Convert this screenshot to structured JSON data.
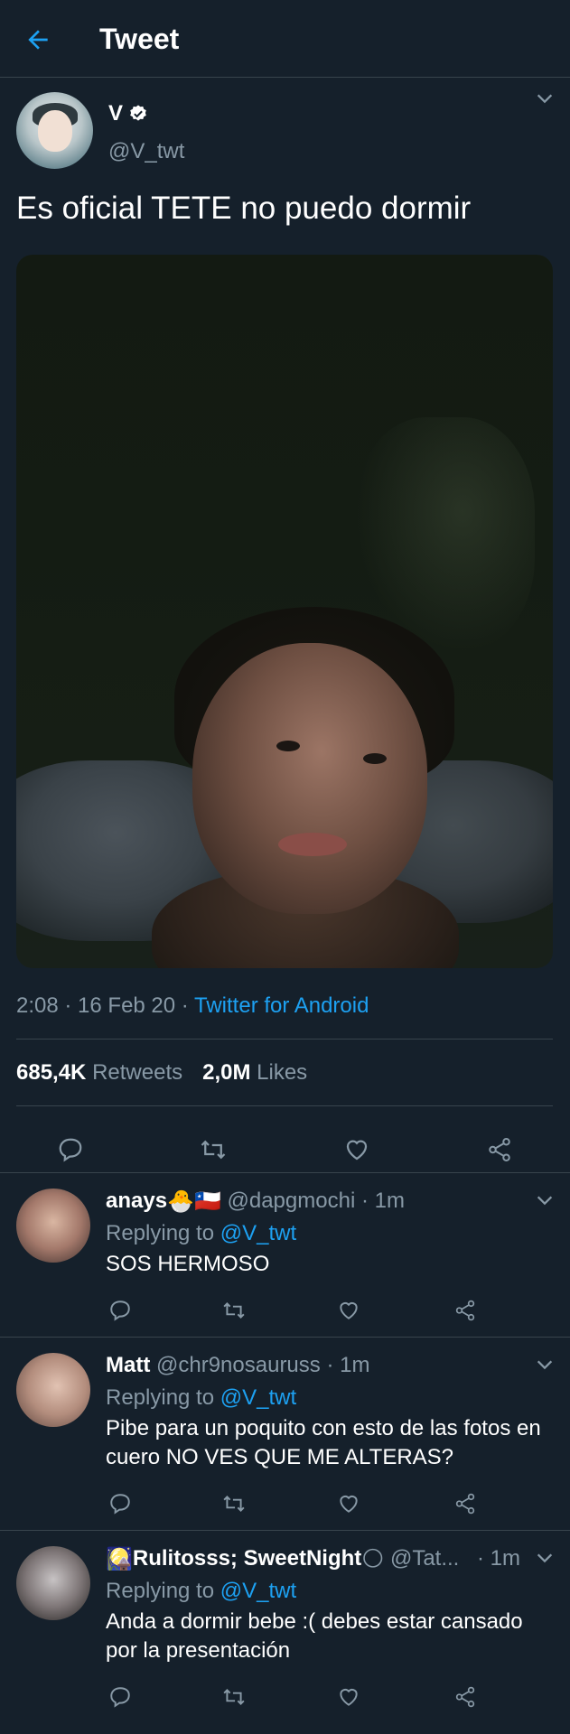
{
  "header": {
    "title": "Tweet"
  },
  "main_tweet": {
    "name": "V",
    "handle": "@V_twt",
    "text": "Es oficial TETE no puedo dormir",
    "time": "2:08 · 16 Feb 20 · ",
    "client": "Twitter for Android",
    "retweets_count": "685,4K",
    "retweets_label": "Retweets",
    "likes_count": "2,0M",
    "likes_label": "Likes"
  },
  "replies": [
    {
      "name": "anays",
      "emojis": "🐣🇨🇱",
      "handle": "@dapgmochi",
      "time": "· 1m",
      "replying_prefix": "Replying to ",
      "mention": "@V_twt",
      "text": "SOS HERMOSO"
    },
    {
      "name": "Matt",
      "emojis": "",
      "handle": "@chr9nosauruss",
      "time": "· 1m",
      "replying_prefix": "Replying to ",
      "mention": "@V_twt",
      "text": "Pibe para un poquito con esto de las fotos en cuero NO VES QUE ME ALTERAS?"
    },
    {
      "name": "Rulitosss; SweetNight",
      "emoji_prefix": "🎑",
      "emoji_suffix": "🌕",
      "handle": "@Tat...",
      "time": "· 1m",
      "replying_prefix": "Replying to ",
      "mention": "@V_twt",
      "text": "Anda a dormir bebe :( debes estar cansado por la presentación"
    }
  ],
  "colors": {
    "background": "#15202b",
    "accent": "#1da1f2",
    "muted": "#8899a6",
    "divider": "#38444d"
  },
  "icons": [
    "back-arrow-icon",
    "verified-badge-icon",
    "chevron-down-icon",
    "reply-icon",
    "retweet-icon",
    "like-icon",
    "share-icon"
  ]
}
